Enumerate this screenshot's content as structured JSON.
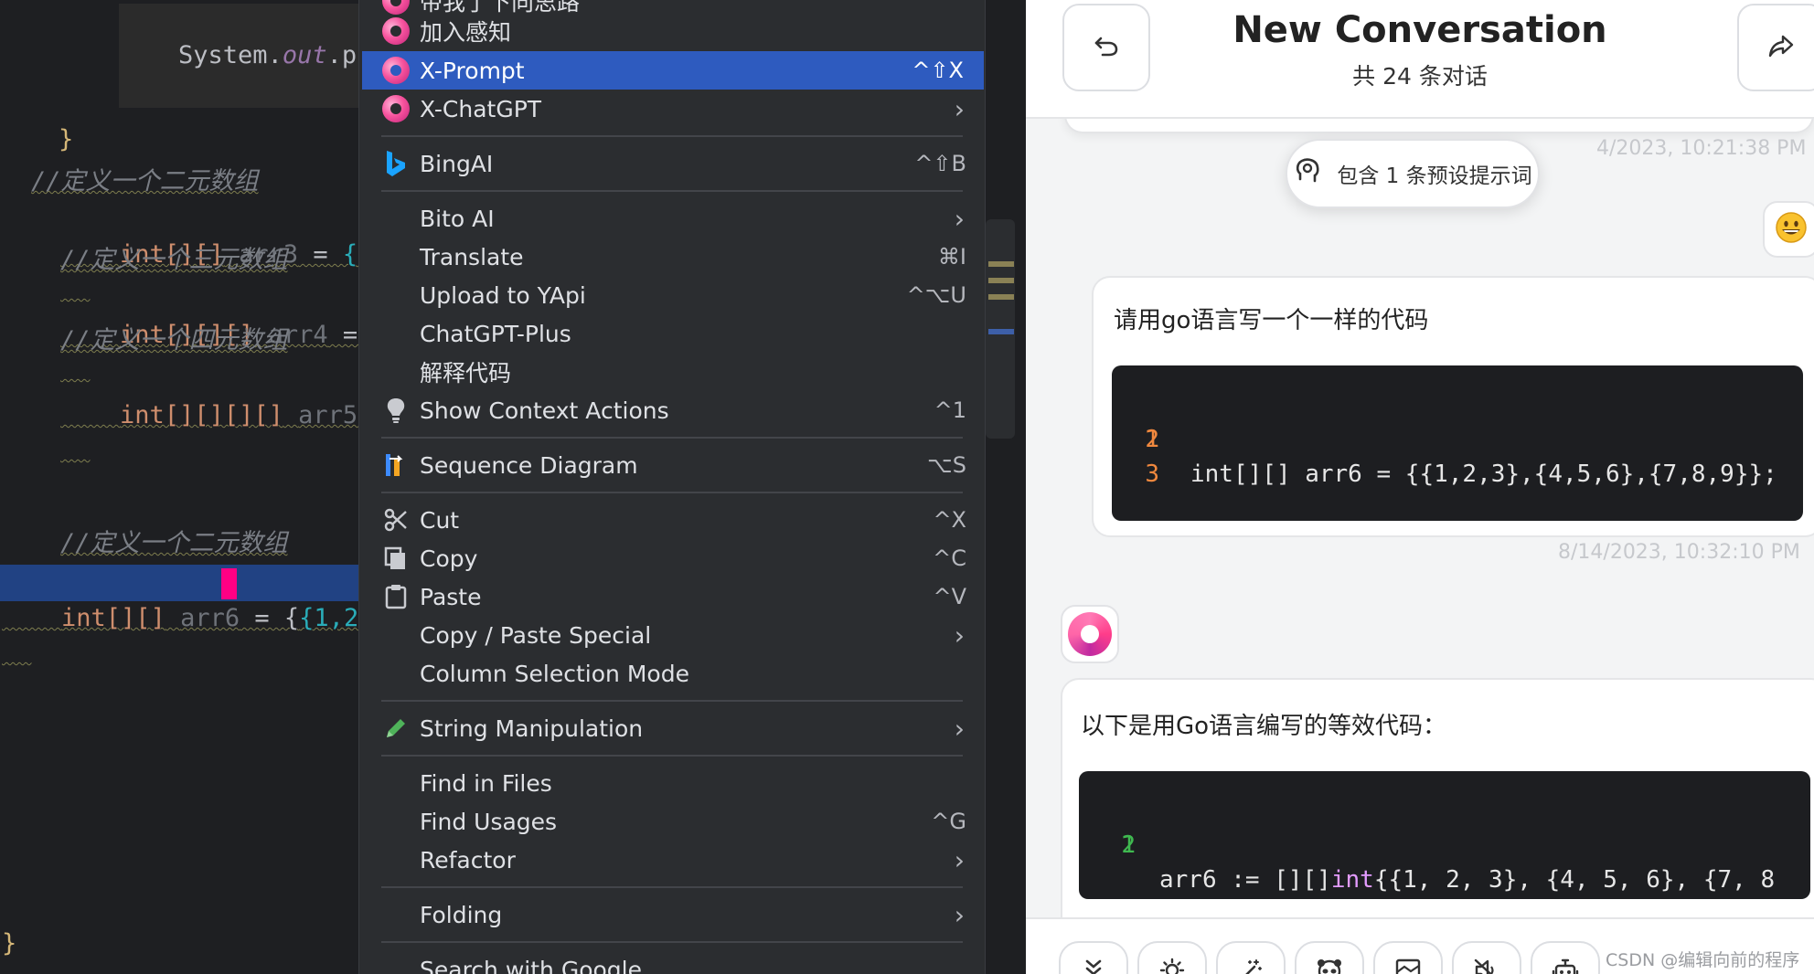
{
  "editor": {
    "lines": [
      {
        "prefix": "System.",
        "obj": "out",
        "rest": ".print"
      },
      {
        "brace": "}"
      },
      {
        "comment": "//定义一个二元数组"
      },
      {
        "type": "int[][]",
        "name": "arr3",
        "op": " = ",
        "val": "{{1,2"
      },
      {
        "comment": "//定义一个三元数组"
      },
      {
        "type": "int[][][]",
        "name": "arr4",
        "op": " = ",
        "val": "{{{"
      },
      {
        "comment": "//定义一个四元数组"
      },
      {
        "type": "int[][][][]",
        "name": "arr5",
        "op": " = ",
        "val": "{"
      },
      {
        "comment": "//定义一个二元数组"
      },
      {
        "type": "int[][]",
        "name": "arr6",
        "op": " = ",
        "open": "{",
        "val": "{1,2,3},"
      },
      {
        "brace": "}"
      }
    ]
  },
  "menu": {
    "items": [
      {
        "label": "带我了下向思路",
        "icon": "openai-icon",
        "shortcut": ""
      },
      {
        "label": "加入感知",
        "icon": "openai-icon",
        "shortcut": ""
      },
      {
        "label": "X-Prompt",
        "icon": "openai-icon",
        "shortcut": "^⇧X",
        "highlighted": true
      },
      {
        "label": "X-ChatGPT",
        "icon": "openai-icon",
        "submenu": "›"
      },
      {
        "label": "BingAI",
        "icon": "bing-icon",
        "shortcut": "^⇧B"
      },
      {
        "label": "Bito AI",
        "submenu": "›"
      },
      {
        "label": "Translate",
        "shortcut": "⌘I"
      },
      {
        "label": "Upload to YApi",
        "shortcut": "^⌥U"
      },
      {
        "label": "ChatGPT-Plus"
      },
      {
        "label": "解释代码"
      },
      {
        "label": "Show Context Actions",
        "icon": "lightbulb-icon",
        "shortcut": "^1"
      },
      {
        "label": "Sequence Diagram",
        "icon": "sequence-diagram-icon",
        "shortcut": "⌥S"
      },
      {
        "label": "Cut",
        "icon": "scissors-icon",
        "shortcut": "^X"
      },
      {
        "label": "Copy",
        "icon": "copy-icon",
        "shortcut": "^C"
      },
      {
        "label": "Paste",
        "icon": "clipboard-icon",
        "shortcut": "^V"
      },
      {
        "label": "Copy / Paste Special",
        "submenu": "›"
      },
      {
        "label": "Column Selection Mode"
      },
      {
        "label": "String Manipulation",
        "icon": "pencil-icon",
        "submenu": "›"
      },
      {
        "label": "Find in Files"
      },
      {
        "label": "Find Usages",
        "shortcut": "^G"
      },
      {
        "label": "Refactor",
        "submenu": "›"
      },
      {
        "label": "Folding",
        "submenu": "›"
      },
      {
        "label": "Search with Google"
      }
    ]
  },
  "chat": {
    "title": "New Conversation",
    "subtitle": "共 24 条对话",
    "prompt_pill": "包含 1 条预设提示词",
    "timestamp_1": "4/2023, 10:21:38 PM",
    "timestamp_2": "8/14/2023, 10:32:10 PM",
    "user_message": "请用go语言写一个一样的代码",
    "user_code": {
      "line_numbers": [
        "1",
        "2",
        "3"
      ],
      "code": "int[][] arr6 = {{1,2,3},{4,5,6},{7,8,9}};"
    },
    "bot_message": "以下是用Go语言编写的等效代码：",
    "bot_code": {
      "line_numbers": [
        "1",
        "2"
      ],
      "code_prefix": "arr6 := [][]",
      "code_type": "int",
      "code_rest": "{{1, 2, 3}, {4, 5, 6}, {7, 8"
    },
    "toolbar_icons": [
      "chevrons-down-icon",
      "sun-icon",
      "magic-wand-icon",
      "mask-icon",
      "image-icon",
      "mute-icon",
      "robot-icon"
    ],
    "watermark": "CSDN @编辑向前的程序"
  },
  "colors": {
    "menu_highlight": "#2e5bbf",
    "editor_bg": "#1e1f22",
    "menu_bg": "#2b2d30",
    "code_block_bg": "#1d1e21",
    "chat_bg": "#f3f4f5"
  }
}
